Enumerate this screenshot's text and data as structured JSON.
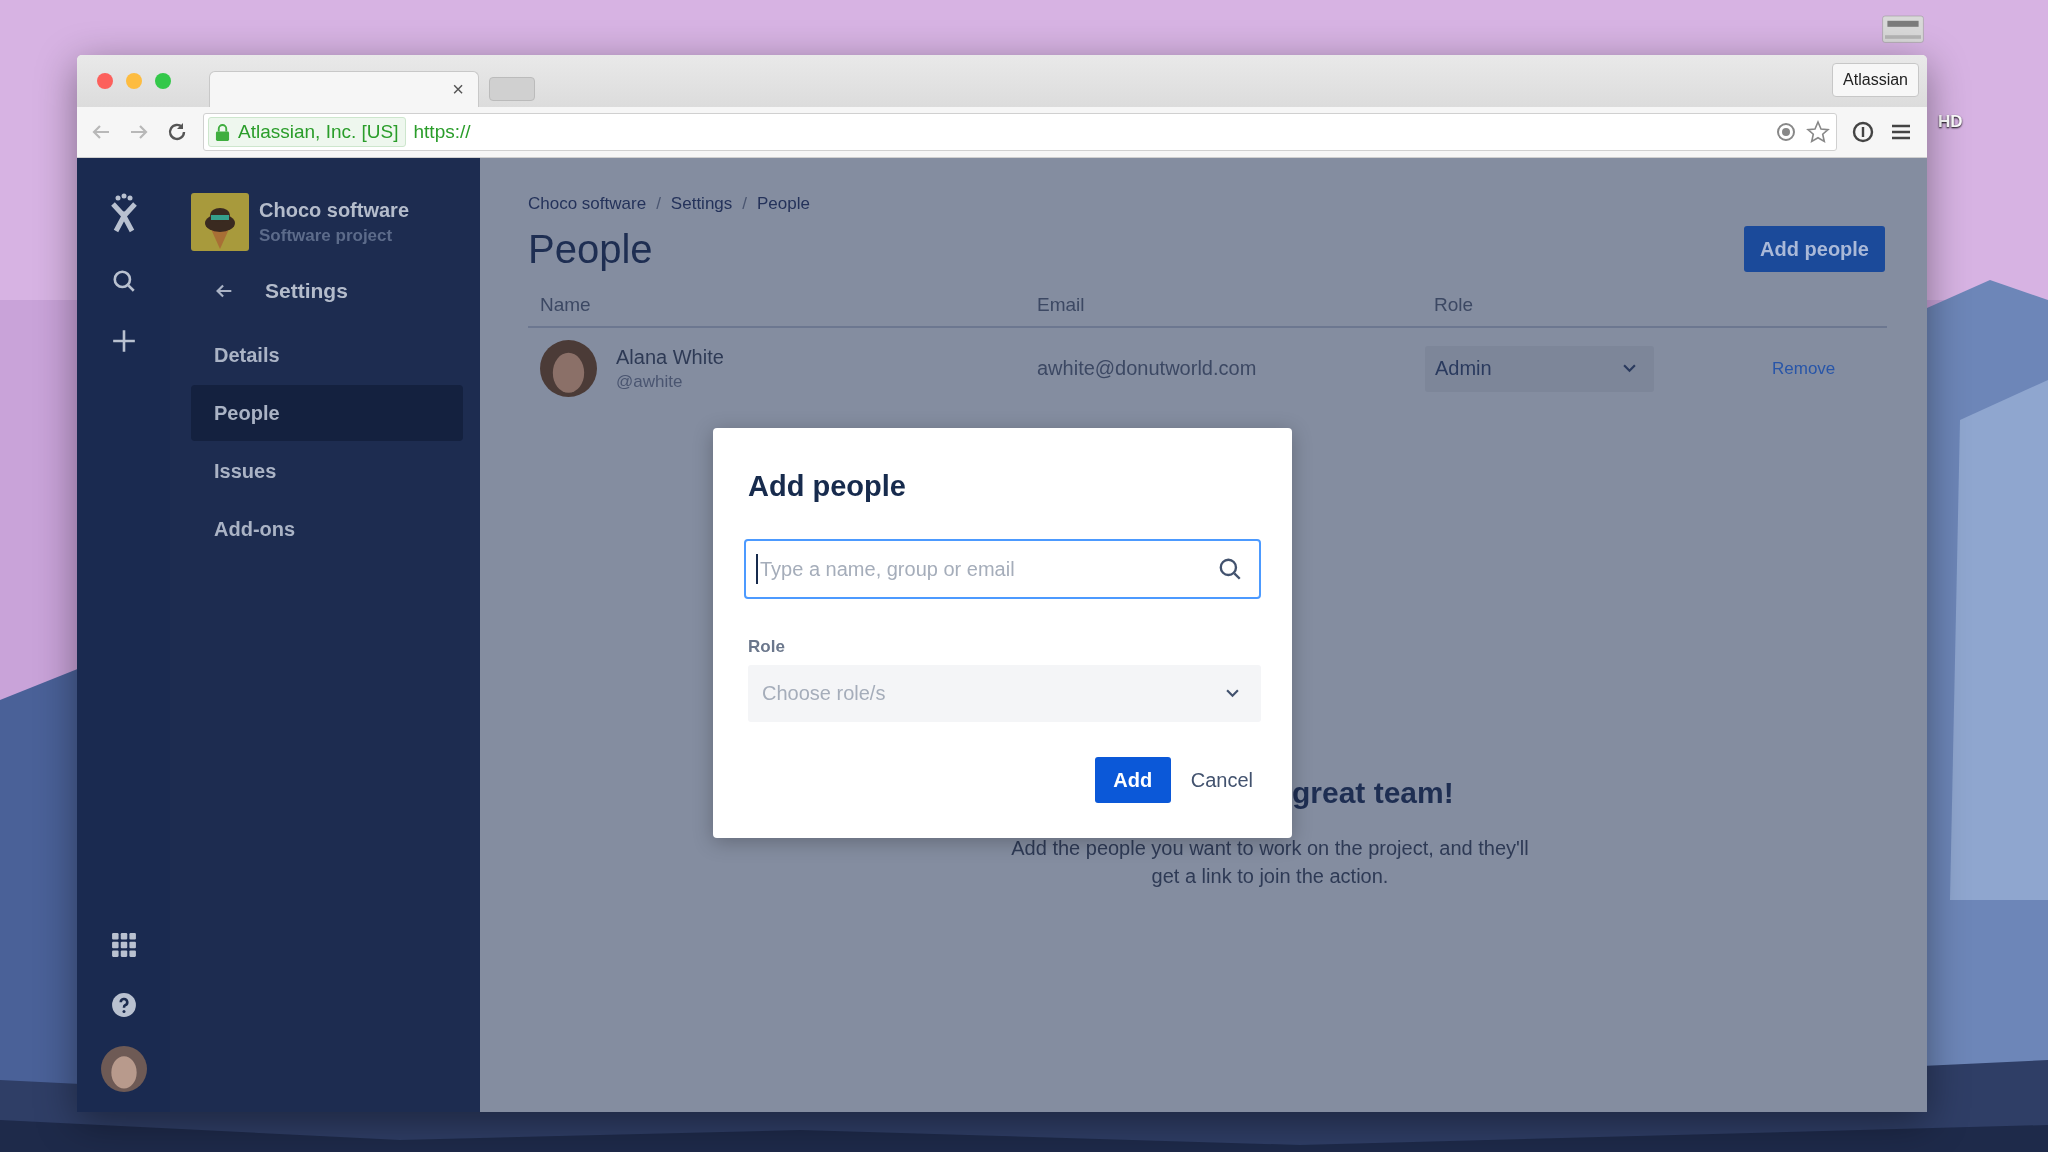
{
  "desktop": {
    "drive_label": "HD"
  },
  "browser": {
    "tab": {
      "close": "×"
    },
    "profile_button": "Atlassian",
    "address": {
      "security_label": "Atlassian, Inc. [US]",
      "url": "https://"
    }
  },
  "sidebar": {
    "project": {
      "name": "Choco software",
      "type": "Software project"
    },
    "back_label": "Settings",
    "items": [
      {
        "label": "Details",
        "selected": false
      },
      {
        "label": "People",
        "selected": true
      },
      {
        "label": "Issues",
        "selected": false
      },
      {
        "label": "Add-ons",
        "selected": false
      }
    ]
  },
  "breadcrumbs": [
    {
      "kind": "link",
      "text": "Choco software"
    },
    {
      "kind": "separator",
      "text": "/"
    },
    {
      "kind": "link",
      "text": "Settings"
    },
    {
      "kind": "separator",
      "text": "/"
    },
    {
      "kind": "link",
      "text": "People"
    }
  ],
  "page_title": "People",
  "add_button": "Add people",
  "table": {
    "columns": [
      "Name",
      "Email",
      "Role"
    ],
    "rows": [
      {
        "name": "Alana White",
        "handle": "@awhite",
        "email": "awhite@donutworld.com",
        "role": "Admin",
        "action": "Remove"
      }
    ]
  },
  "background_message": {
    "heading": "great team!",
    "lines": [
      "Add the people you want to work on the project, and they'll",
      "get a link to join the action."
    ]
  },
  "dialog": {
    "title": "Add people",
    "search": {
      "placeholder": "Type a name, group or email"
    },
    "role_label": "Role",
    "role_select": {
      "placeholder": "Choose role/s"
    },
    "buttons": [
      {
        "label": "Add",
        "kind": "primary"
      },
      {
        "label": "Cancel",
        "kind": "subtle"
      }
    ]
  }
}
